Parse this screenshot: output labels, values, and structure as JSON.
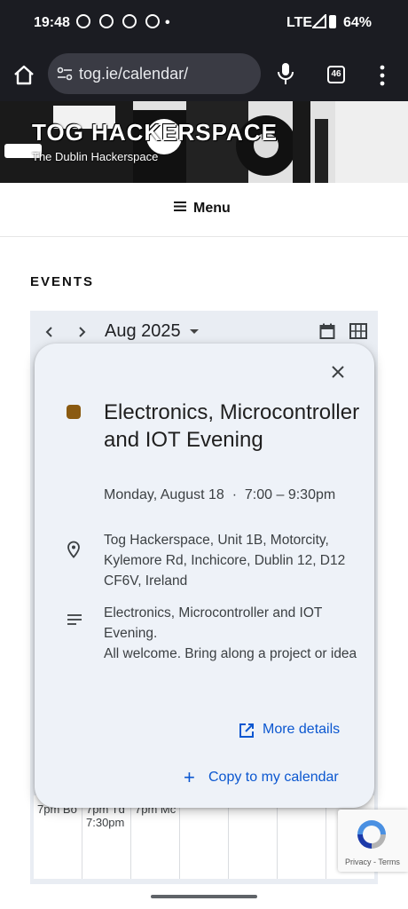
{
  "status_bar": {
    "time": "19:48",
    "network": "LTE",
    "battery": "64%"
  },
  "browser": {
    "url": "tog.ie/calendar/",
    "tab_count": "46"
  },
  "site": {
    "title": "TOG HACKERSPACE",
    "tagline": "The Dublin Hackerspace",
    "menu_label": "Menu"
  },
  "page": {
    "heading": "EVENTS"
  },
  "calendar": {
    "month": "Aug 2025",
    "week_cells": [
      "7pm Bo",
      "7pm Td 7:30pm",
      "7pm Mc",
      "",
      "",
      "",
      ""
    ]
  },
  "event": {
    "color": "#8a5a11",
    "title": "Electronics, Microcontroller and IOT Evening",
    "when": "Monday, August 18  ·  7:00 – 9:30pm",
    "location": "Tog Hackerspace, Unit 1B, Motorcity, Kylemore Rd, Inchicore, Dublin 12, D12 CF6V, Ireland",
    "description": "Electronics, Microcontroller and IOT Evening.\nAll welcome. Bring along a project or idea",
    "more_details_label": "More details",
    "copy_label": "Copy to my calendar"
  },
  "recaptcha": {
    "terms": "Privacy - Terms"
  }
}
